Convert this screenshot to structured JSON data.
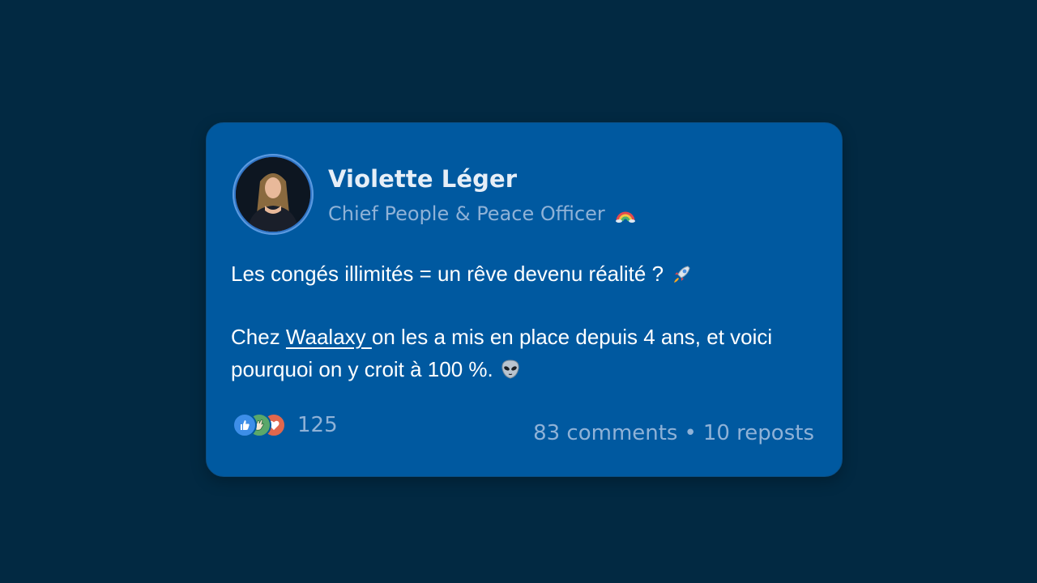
{
  "post": {
    "author_name": "Violette Léger",
    "author_title": "Chief People & Peace Officer",
    "title_icon": "rainbow-icon",
    "line1": "Les congés illimités = un rêve devenu réalité ?",
    "line1_icon": "rocket-icon",
    "line2_prefix": "Chez ",
    "link_text": "Waalaxy ",
    "line2_rest": "on les a mis en place depuis 4 ans, et voici pourquoi on y croit à 100 %.",
    "line2_icon": "alien-icon"
  },
  "engagement": {
    "reaction_icons": [
      "like-icon",
      "celebrate-icon",
      "love-icon"
    ],
    "reaction_count": "125",
    "comments": "83 comments",
    "separator": "•",
    "reposts": "10 reposts"
  },
  "colors": {
    "background": "#022942",
    "card": "#0059A0",
    "muted_text": "#8FB2D7",
    "name_text": "#E6EEF7"
  }
}
